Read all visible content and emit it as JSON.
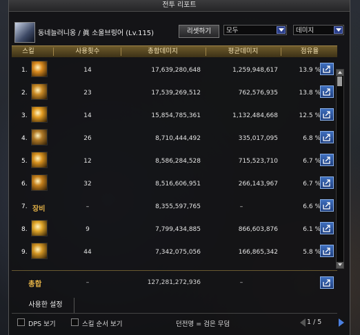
{
  "window": {
    "title": "전투 리포트"
  },
  "character": {
    "name": "동네늘러니옹 / 眞 소울브링어 (Lv.115)"
  },
  "toolbar": {
    "reset_label": "리셋하기",
    "filter_value": "모두",
    "metric_value": "데미지"
  },
  "table": {
    "headers": {
      "skill": "스킬",
      "uses": "사용횟수",
      "total": "총합데미지",
      "avg": "평균데미지",
      "share": "점유율"
    },
    "rows": [
      {
        "idx": "1.",
        "icon": "skill-icon",
        "icon_color": "#d98a1f",
        "uses": "14",
        "total": "17,639,280,648",
        "avg": "1,259,948,617",
        "share": "13.9 %"
      },
      {
        "idx": "2.",
        "icon": "skill-icon",
        "icon_color": "#c98a26",
        "uses": "23",
        "total": "17,539,269,512",
        "avg": "762,576,935",
        "share": "13.8 %"
      },
      {
        "idx": "3.",
        "icon": "skill-icon",
        "icon_color": "#e29b21",
        "uses": "14",
        "total": "15,854,785,361",
        "avg": "1,132,484,668",
        "share": "12.5 %"
      },
      {
        "idx": "4.",
        "icon": "skill-icon",
        "icon_color": "#b07a28",
        "uses": "26",
        "total": "8,710,444,492",
        "avg": "335,017,095",
        "share": "6.8 %"
      },
      {
        "idx": "5.",
        "icon": "skill-icon",
        "icon_color": "#d6901e",
        "uses": "12",
        "total": "8,586,284,528",
        "avg": "715,523,710",
        "share": "6.7 %"
      },
      {
        "idx": "6.",
        "icon": "skill-icon",
        "icon_color": "#c47f1c",
        "uses": "32",
        "total": "8,516,606,951",
        "avg": "266,143,967",
        "share": "6.7 %"
      },
      {
        "idx": "7.",
        "icon": "",
        "icon_color": "",
        "label": "장비",
        "uses": "–",
        "total": "8,355,597,765",
        "avg": "–",
        "share": "6.6 %"
      },
      {
        "idx": "8.",
        "icon": "skill-icon",
        "icon_color": "#e0a62a",
        "uses": "9",
        "total": "7,799,434,885",
        "avg": "866,603,876",
        "share": "6.1 %"
      },
      {
        "idx": "9.",
        "icon": "skill-icon",
        "icon_color": "#d29524",
        "uses": "44",
        "total": "7,342,075,056",
        "avg": "166,865,342",
        "share": "5.8 %"
      }
    ],
    "summary": {
      "label": "총합",
      "uses": "–",
      "total": "127,281,272,936",
      "avg": "–"
    }
  },
  "tabs": {
    "settings_label": "사용한 설정"
  },
  "footer": {
    "dps_label": "DPS 보기",
    "skill_order_label": "스킬 순서 보기",
    "note": "던전명 = 검은 무덤",
    "pager": "1 / 5"
  }
}
